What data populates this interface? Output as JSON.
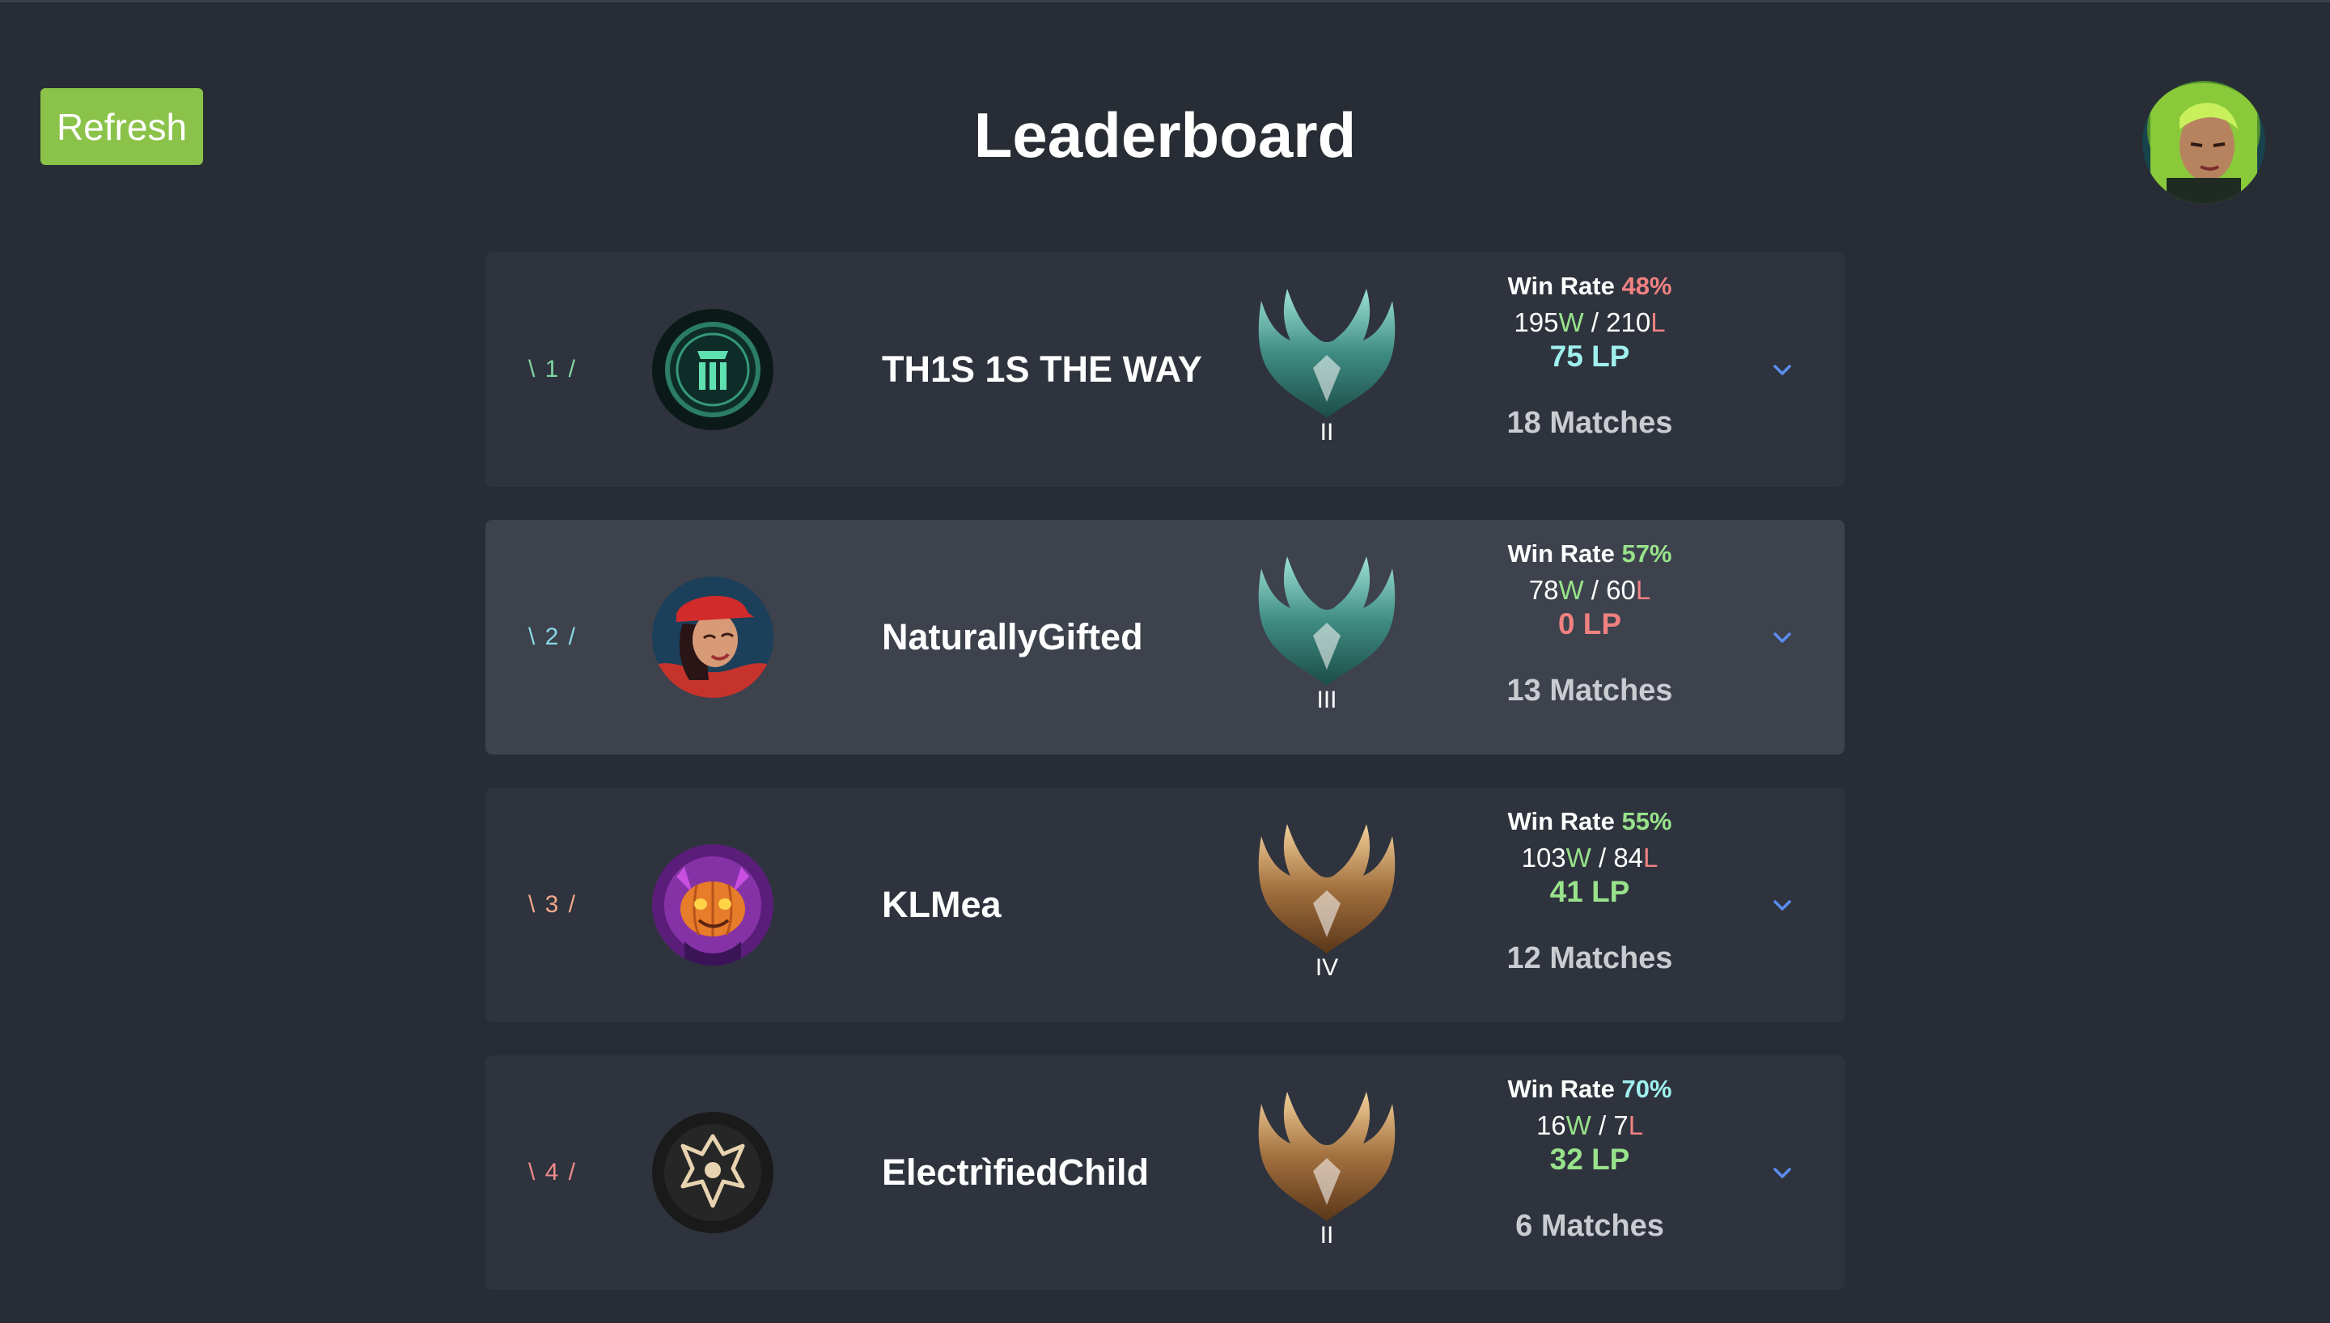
{
  "header": {
    "title": "Leaderboard",
    "refresh_label": "Refresh"
  },
  "colors": {
    "background": "#282c34",
    "row": "#2e333d",
    "row_highlight": "#3d424d",
    "refresh_button": "#8bc34a",
    "win": "#98e28b",
    "loss": "#f08181",
    "lp_top": "#9ff0ee",
    "chevron": "#5b8def"
  },
  "players": [
    {
      "rank_label": "\\ 1 /",
      "rank_color": "#7fd6a3",
      "name": "TH1S 1S THE WAY",
      "tier_icon": "emerald-emblem-icon",
      "division": "II",
      "win_rate_label": "Win Rate",
      "win_rate": "48%",
      "win_rate_color": "#f08181",
      "wins": "195",
      "w_suffix": "W",
      "sep": " / ",
      "losses": "210",
      "l_suffix": "L",
      "lp": "75 LP",
      "lp_color": "#9ff0ee",
      "matches": "18 Matches",
      "avatar_icon": "emerald-crest-avatar-icon"
    },
    {
      "rank_label": "\\ 2 /",
      "rank_color": "#8ad8e6",
      "name": "NaturallyGifted",
      "tier_icon": "emerald-emblem-icon",
      "division": "III",
      "win_rate_label": "Win Rate",
      "win_rate": "57%",
      "win_rate_color": "#98e28b",
      "wins": "78",
      "w_suffix": "W",
      "sep": " / ",
      "losses": "60",
      "l_suffix": "L",
      "lp": "0 LP",
      "lp_color": "#f08181",
      "matches": "13 Matches",
      "avatar_icon": "red-cap-champion-avatar-icon"
    },
    {
      "rank_label": "\\ 3 /",
      "rank_color": "#f0a78a",
      "name": "KLMea",
      "tier_icon": "gold-emblem-icon",
      "division": "IV",
      "win_rate_label": "Win Rate",
      "win_rate": "55%",
      "win_rate_color": "#98e28b",
      "wins": "103",
      "w_suffix": "W",
      "sep": " / ",
      "losses": "84",
      "l_suffix": "L",
      "lp": "41 LP",
      "lp_color": "#98e28b",
      "matches": "12 Matches",
      "avatar_icon": "pumpkin-avatar-icon"
    },
    {
      "rank_label": "\\ 4 /",
      "rank_color": "#f08a8a",
      "name": "ElectrìfiedChild",
      "tier_icon": "gold-emblem-icon",
      "division": "II",
      "win_rate_label": "Win Rate",
      "win_rate": "70%",
      "win_rate_color": "#9ff0ee",
      "wins": "16",
      "w_suffix": "W",
      "sep": " / ",
      "losses": "7",
      "l_suffix": "L",
      "lp": "32 LP",
      "lp_color": "#98e28b",
      "matches": "6 Matches",
      "avatar_icon": "worlds-trophy-avatar-icon"
    }
  ],
  "user": {
    "avatar_icon": "green-hair-champion-avatar-icon"
  }
}
